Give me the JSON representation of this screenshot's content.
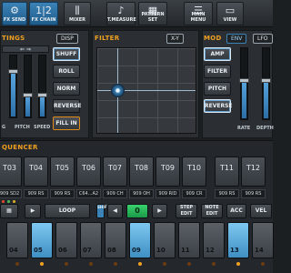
{
  "toolbar": {
    "buttons": [
      {
        "label": "FX SEND",
        "icon": "tune-icon",
        "glyph": "⚙",
        "active": true
      },
      {
        "label": "FX CHAIN",
        "icon": "chain-icon",
        "glyph": "1|2",
        "active": true
      },
      {
        "label": "MIXER",
        "icon": "mixer-icon",
        "glyph": "⫼",
        "active": false
      },
      {
        "label": "T.MEASURE",
        "icon": "tempo-icon",
        "glyph": "♪",
        "active": false
      },
      {
        "label": "PATTERN SET",
        "icon": "pattern-icon",
        "glyph": "▦",
        "active": false
      },
      {
        "label": "MAIN MENU",
        "icon": "menu-icon",
        "glyph": "☰",
        "active": false
      },
      {
        "label": "VIEW",
        "icon": "view-icon",
        "glyph": "▭",
        "active": false
      }
    ]
  },
  "settings": {
    "title": "TINGS",
    "disp_label": "DISP",
    "shuffle_label": "SHUFF",
    "roll_label": "ROLL",
    "norm_label": "NORM",
    "reverse_label": "REVERSE",
    "fillin_label": "FILL IN",
    "slider_labels": [
      "G",
      "PITCH",
      "SPEED"
    ],
    "slider_levels": [
      0.7,
      0.35,
      0.35
    ]
  },
  "filter": {
    "title": "FILTER",
    "mode_label": "X-Y"
  },
  "mod": {
    "title": "MOD",
    "env_label": "ENV",
    "lfo_label": "LFO",
    "amp_label": "AMP",
    "filter_label": "FILTER",
    "pitch_label": "PITCH",
    "reverse_label": "REVERSE",
    "slider_labels": [
      "RATE",
      "DEPTH"
    ],
    "slider_levels": [
      0.55,
      0.55
    ]
  },
  "sequencer": {
    "title": "QUENCER",
    "tracks": [
      {
        "name": "T03",
        "sub": "909 SD2"
      },
      {
        "name": "T04",
        "sub": "909 RS"
      },
      {
        "name": "T05",
        "sub": "909 RS"
      },
      {
        "name": "T06",
        "sub": "C64...A2"
      },
      {
        "name": "T07",
        "sub": "909 CH"
      },
      {
        "name": "T08",
        "sub": "909 OH"
      },
      {
        "name": "T09",
        "sub": "909 RID"
      },
      {
        "name": "T10",
        "sub": "909 CR"
      },
      {
        "name": "T11",
        "sub": "909 RS"
      },
      {
        "name": "T12",
        "sub": "909 RS"
      }
    ],
    "loop_label": "LOOP",
    "shift_label": "SHIFT",
    "pattern_value": "0",
    "step_edit_label": "STEP EDIT",
    "note_edit_label": "NOTE EDIT",
    "acc_label": "ACC",
    "vel_label": "VEL",
    "steps": [
      {
        "label": "04",
        "on": false
      },
      {
        "label": "05",
        "on": true
      },
      {
        "label": "06",
        "on": false
      },
      {
        "label": "07",
        "on": false
      },
      {
        "label": "08",
        "on": false
      },
      {
        "label": "09",
        "on": true
      },
      {
        "label": "10",
        "on": false
      },
      {
        "label": "11",
        "on": false
      },
      {
        "label": "12",
        "on": false
      },
      {
        "label": "13",
        "on": true
      },
      {
        "label": "14",
        "on": false
      }
    ]
  },
  "colors": {
    "accent": "#3b82b6",
    "title": "#f0a020",
    "step_on": "#7ec8f0",
    "pattern": "#39d26d"
  }
}
